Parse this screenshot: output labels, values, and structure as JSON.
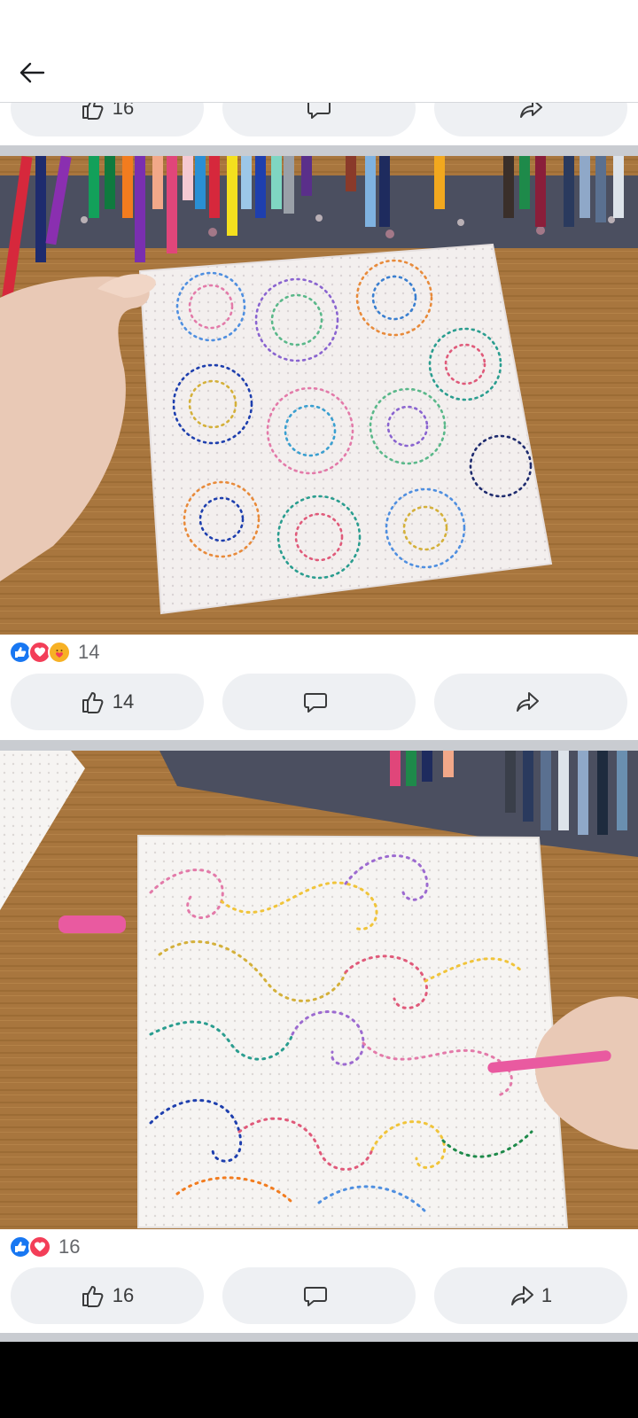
{
  "header": {
    "back_icon": "arrow-left-icon"
  },
  "partial_post": {
    "like_count": "16"
  },
  "posts": [
    {
      "reactions": [
        "like",
        "love",
        "care"
      ],
      "reaction_count": "14",
      "like_count": "14",
      "comment_count": "",
      "share_count": ""
    },
    {
      "reactions": [
        "like",
        "love"
      ],
      "reaction_count": "16",
      "like_count": "16",
      "comment_count": "",
      "share_count": "1"
    }
  ],
  "colors": {
    "pill_bg": "#eef0f3",
    "divider": "#c9ccd1",
    "like_blue": "#1877f2",
    "love_red": "#f33e58",
    "care_yellow": "#f7b125",
    "wood": "#a8763e"
  }
}
